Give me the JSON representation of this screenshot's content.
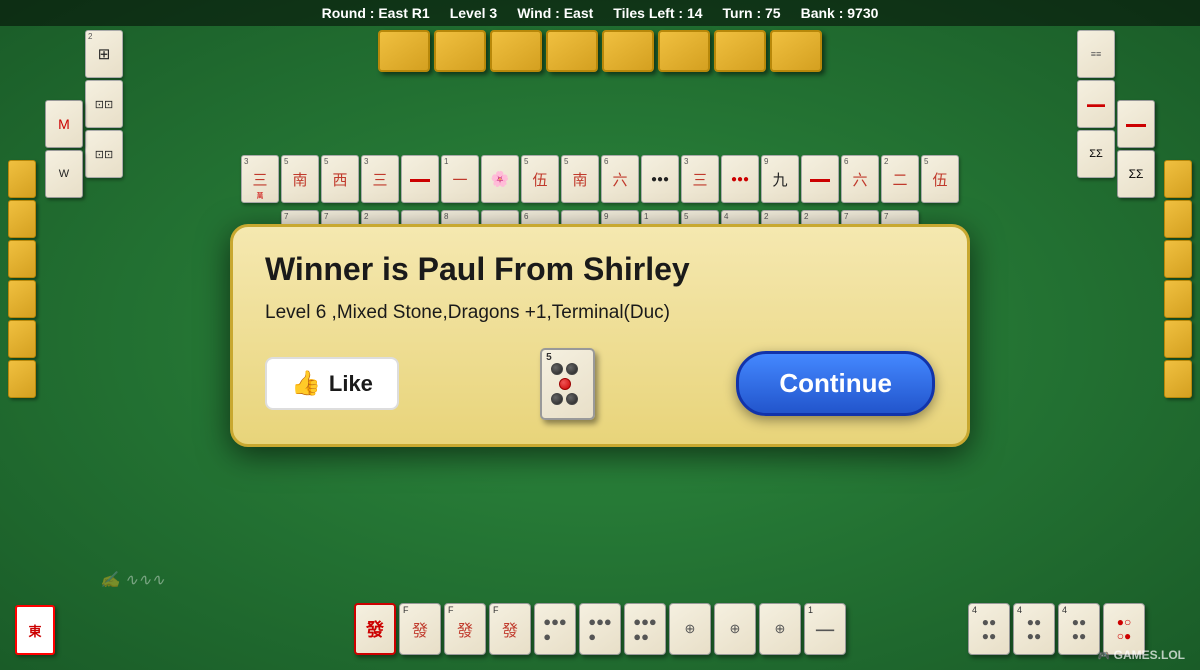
{
  "header": {
    "round": "Round : East R1",
    "level": "Level 3",
    "wind": "Wind : East",
    "tiles_left": "Tiles Left : 14",
    "turn": "Turn : 75",
    "bank": "Bank : 9730"
  },
  "modal": {
    "title": "Winner is Paul From Shirley",
    "subtitle": "Level 6 ,Mixed Stone,Dragons +1,Terminal(Duc)",
    "like_label": "Like",
    "continue_label": "Continue",
    "winning_tile_num": "5"
  },
  "east_tile_label": "東",
  "games_logo": "GAMES.LOL",
  "watermark": "✍",
  "top_gold_count": 8,
  "left_gold_count": 6,
  "right_gold_count": 6
}
